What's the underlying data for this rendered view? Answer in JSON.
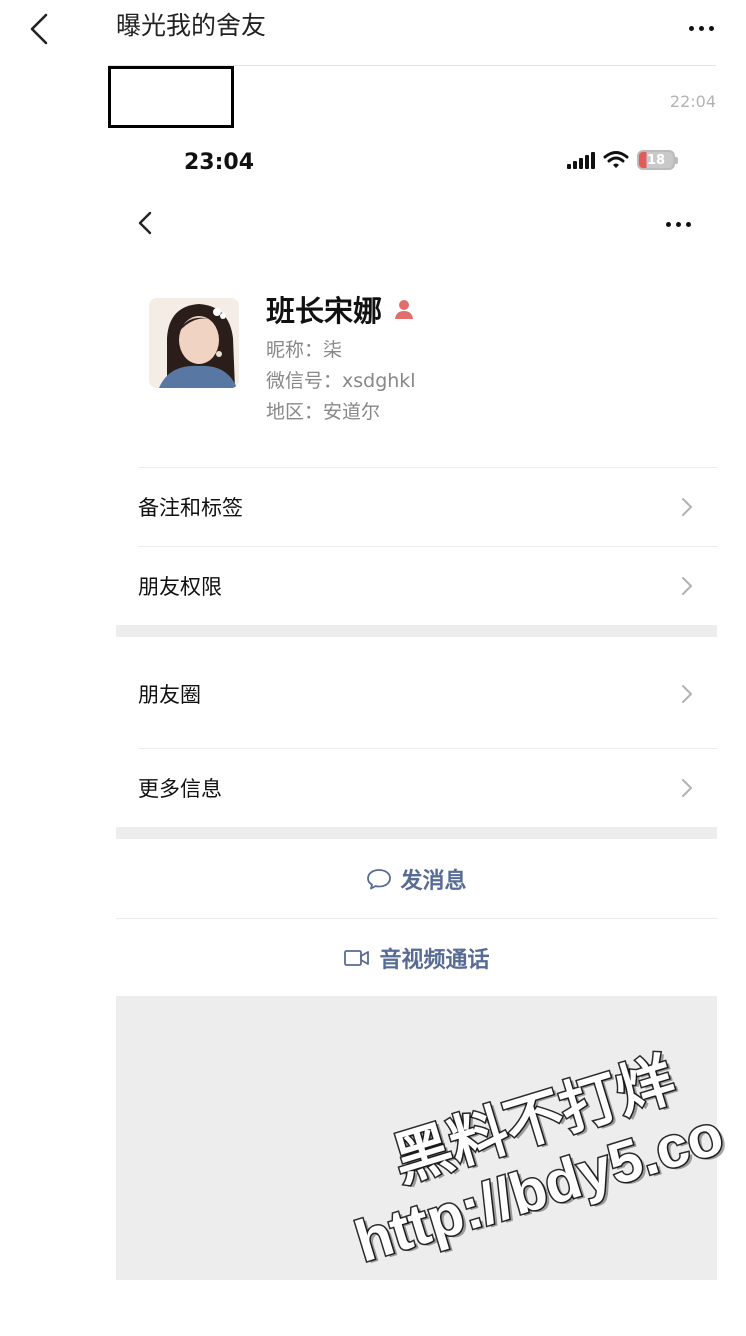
{
  "chat": {
    "title": "曝光我的舍友",
    "time": "22:04"
  },
  "status_bar": {
    "time": "23:04",
    "battery": "18"
  },
  "profile": {
    "name": "班长宋娜",
    "nickname": "昵称：柒",
    "wechat_id": "微信号：xsdghkl",
    "region": "地区：安道尔"
  },
  "menu": {
    "remark_tags": "备注和标签",
    "friend_permissions": "朋友权限",
    "moments": "朋友圈",
    "more_info": "更多信息"
  },
  "actions": {
    "send_message": "发消息",
    "video_call": "音视频通话"
  },
  "watermark": {
    "line1": "黑料不打烊",
    "line2": "http://bdy5.co"
  },
  "colors": {
    "link_blue": "#576b95",
    "gender_icon": "#e26d6d",
    "battery_low": "#e25b5b"
  }
}
